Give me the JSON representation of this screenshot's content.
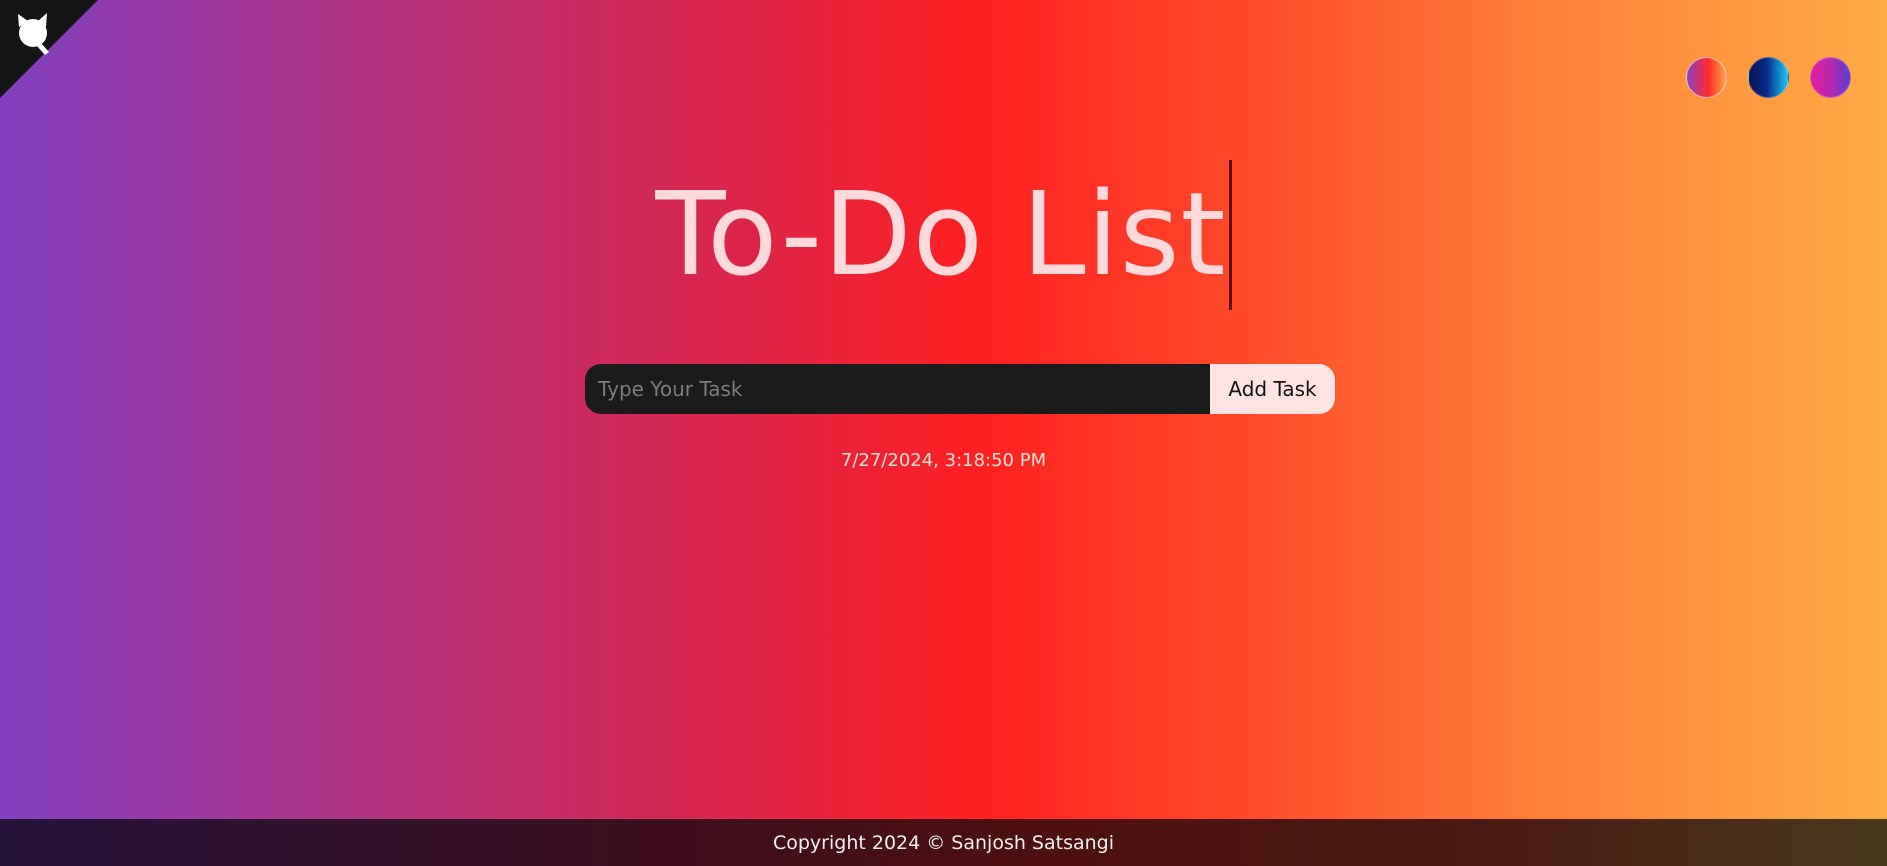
{
  "header": {
    "corner_icon": "github-corner-icon",
    "title": "To-Do List"
  },
  "theme_switcher": {
    "swatches": [
      {
        "name": "sunset-theme",
        "colors": [
          "#8a3fbf",
          "#ff2a2a",
          "#ffa246"
        ]
      },
      {
        "name": "ocean-theme",
        "colors": [
          "#06124f",
          "#0a2a8a",
          "#19c8f0"
        ]
      },
      {
        "name": "magenta-theme",
        "colors": [
          "#e51b9c",
          "#b22ab0",
          "#5a3cd6"
        ]
      }
    ]
  },
  "task_form": {
    "input_value": "",
    "placeholder": "Type Your Task",
    "add_label": "Add Task"
  },
  "datetime": "7/27/2024, 3:18:50 PM",
  "footer": {
    "copyright": "Copyright 2024 © Sanjosh Satsangi"
  },
  "colors": {
    "title_text": "#ffd9dc",
    "input_bg": "#1b1b1b",
    "button_bg": "#fde4e2"
  }
}
